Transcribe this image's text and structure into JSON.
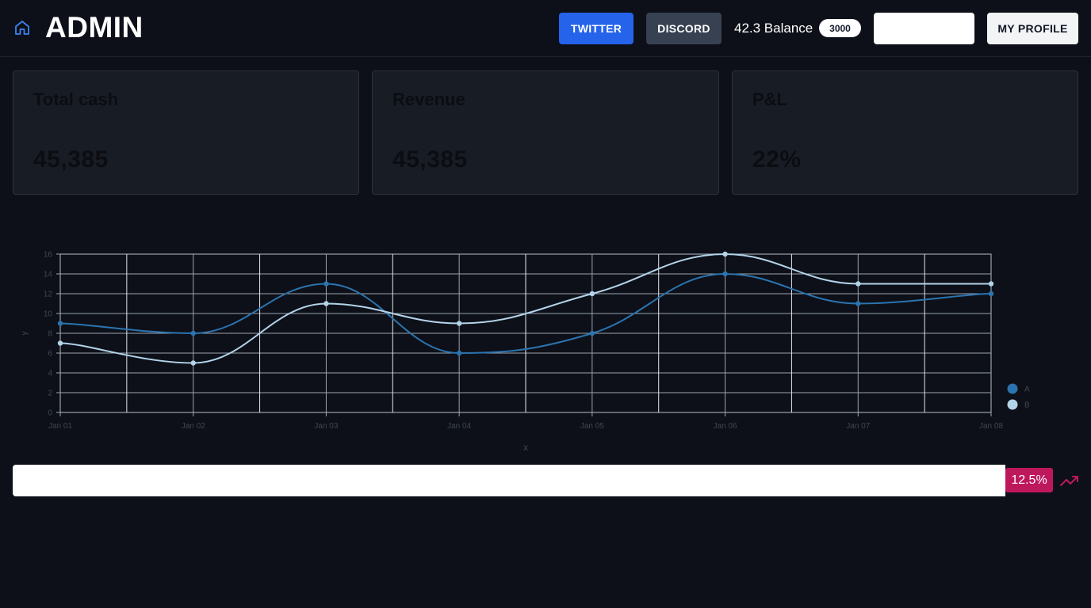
{
  "header": {
    "brand": "ADMIN",
    "twitter_label": "TWITTER",
    "discord_label": "DISCORD",
    "balance_text": "42.3 Balance",
    "balance_badge": "3000",
    "search_value": "",
    "profile_label": "MY PROFILE",
    "home_icon": "home-icon"
  },
  "cards": [
    {
      "title": "Total cash",
      "value": "45,385"
    },
    {
      "title": "Revenue",
      "value": "45,385"
    },
    {
      "title": "P&L",
      "value": "22%"
    }
  ],
  "chart_data": {
    "type": "line",
    "x": [
      "Jan 01",
      "Jan 02",
      "Jan 03",
      "Jan 04",
      "Jan 05",
      "Jan 06",
      "Jan 07",
      "Jan 08"
    ],
    "series": [
      {
        "name": "A",
        "values": [
          9,
          8,
          13,
          6,
          8,
          14,
          11,
          12
        ],
        "color": "#2b74b0"
      },
      {
        "name": "B",
        "values": [
          7,
          5,
          11,
          9,
          12,
          16,
          13,
          13
        ],
        "color": "#b3d4ea"
      }
    ],
    "xlabel": "x",
    "ylabel": "y",
    "ylim": [
      0,
      16
    ],
    "yticks": [
      "0",
      "2",
      "4",
      "6",
      "8",
      "10",
      "12",
      "14",
      "16"
    ],
    "grid": true,
    "legend": "right"
  },
  "footer": {
    "input_value": "",
    "percent": "12.5%",
    "trend_icon": "trending-up-icon",
    "accent_color": "#be185d"
  },
  "colors": {
    "background": "#0d1018",
    "card": "#181c24",
    "twitter": "#2563eb",
    "discord": "#374151"
  }
}
